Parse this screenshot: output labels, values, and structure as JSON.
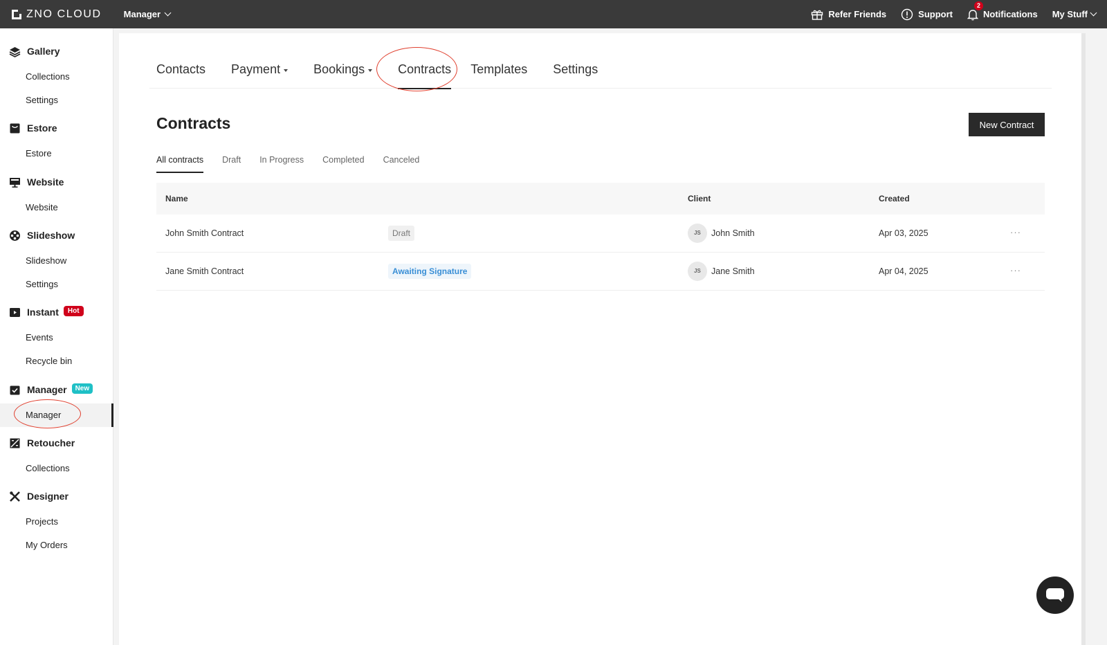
{
  "topbar": {
    "logo_text": "ZNO CLOUD",
    "app_switch": "Manager",
    "refer_friends": "Refer Friends",
    "support": "Support",
    "notifications": "Notifications",
    "notifications_count": "2",
    "my_stuff": "My Stuff"
  },
  "sidebar": {
    "gallery": {
      "label": "Gallery",
      "items": [
        "Collections",
        "Settings"
      ]
    },
    "estore": {
      "label": "Estore",
      "items": [
        "Estore"
      ]
    },
    "website": {
      "label": "Website",
      "items": [
        "Website"
      ]
    },
    "slideshow": {
      "label": "Slideshow",
      "items": [
        "Slideshow",
        "Settings"
      ]
    },
    "instant": {
      "label": "Instant",
      "badge": "Hot",
      "items": [
        "Events",
        "Recycle bin"
      ]
    },
    "manager": {
      "label": "Manager",
      "badge": "New",
      "items": [
        "Manager"
      ]
    },
    "retoucher": {
      "label": "Retoucher",
      "items": [
        "Collections"
      ]
    },
    "designer": {
      "label": "Designer",
      "items": [
        "Projects",
        "My Orders"
      ]
    }
  },
  "tabs": [
    "Contacts",
    "Payment",
    "Bookings",
    "Contracts",
    "Templates",
    "Settings"
  ],
  "page": {
    "title": "Contracts",
    "new_button": "New Contract"
  },
  "subtabs": [
    "All contracts",
    "Draft",
    "In Progress",
    "Completed",
    "Canceled"
  ],
  "table": {
    "headers": {
      "name": "Name",
      "client": "Client",
      "created": "Created"
    },
    "rows": [
      {
        "name": "John Smith Contract",
        "status": "Draft",
        "initials": "JS",
        "client": "John Smith",
        "created": "Apr 03, 2025",
        "more": "···"
      },
      {
        "name": "Jane Smith Contract",
        "status": "Awaiting Signature",
        "initials": "JS",
        "client": "Jane Smith",
        "created": "Apr 04, 2025",
        "more": "···"
      }
    ]
  },
  "colors": {
    "topbar": "#3a3a3a",
    "accent_red": "#d0021b",
    "new_badge": "#1fc0c6",
    "link_blue": "#3a8fd6",
    "annotation": "#e0402f"
  }
}
